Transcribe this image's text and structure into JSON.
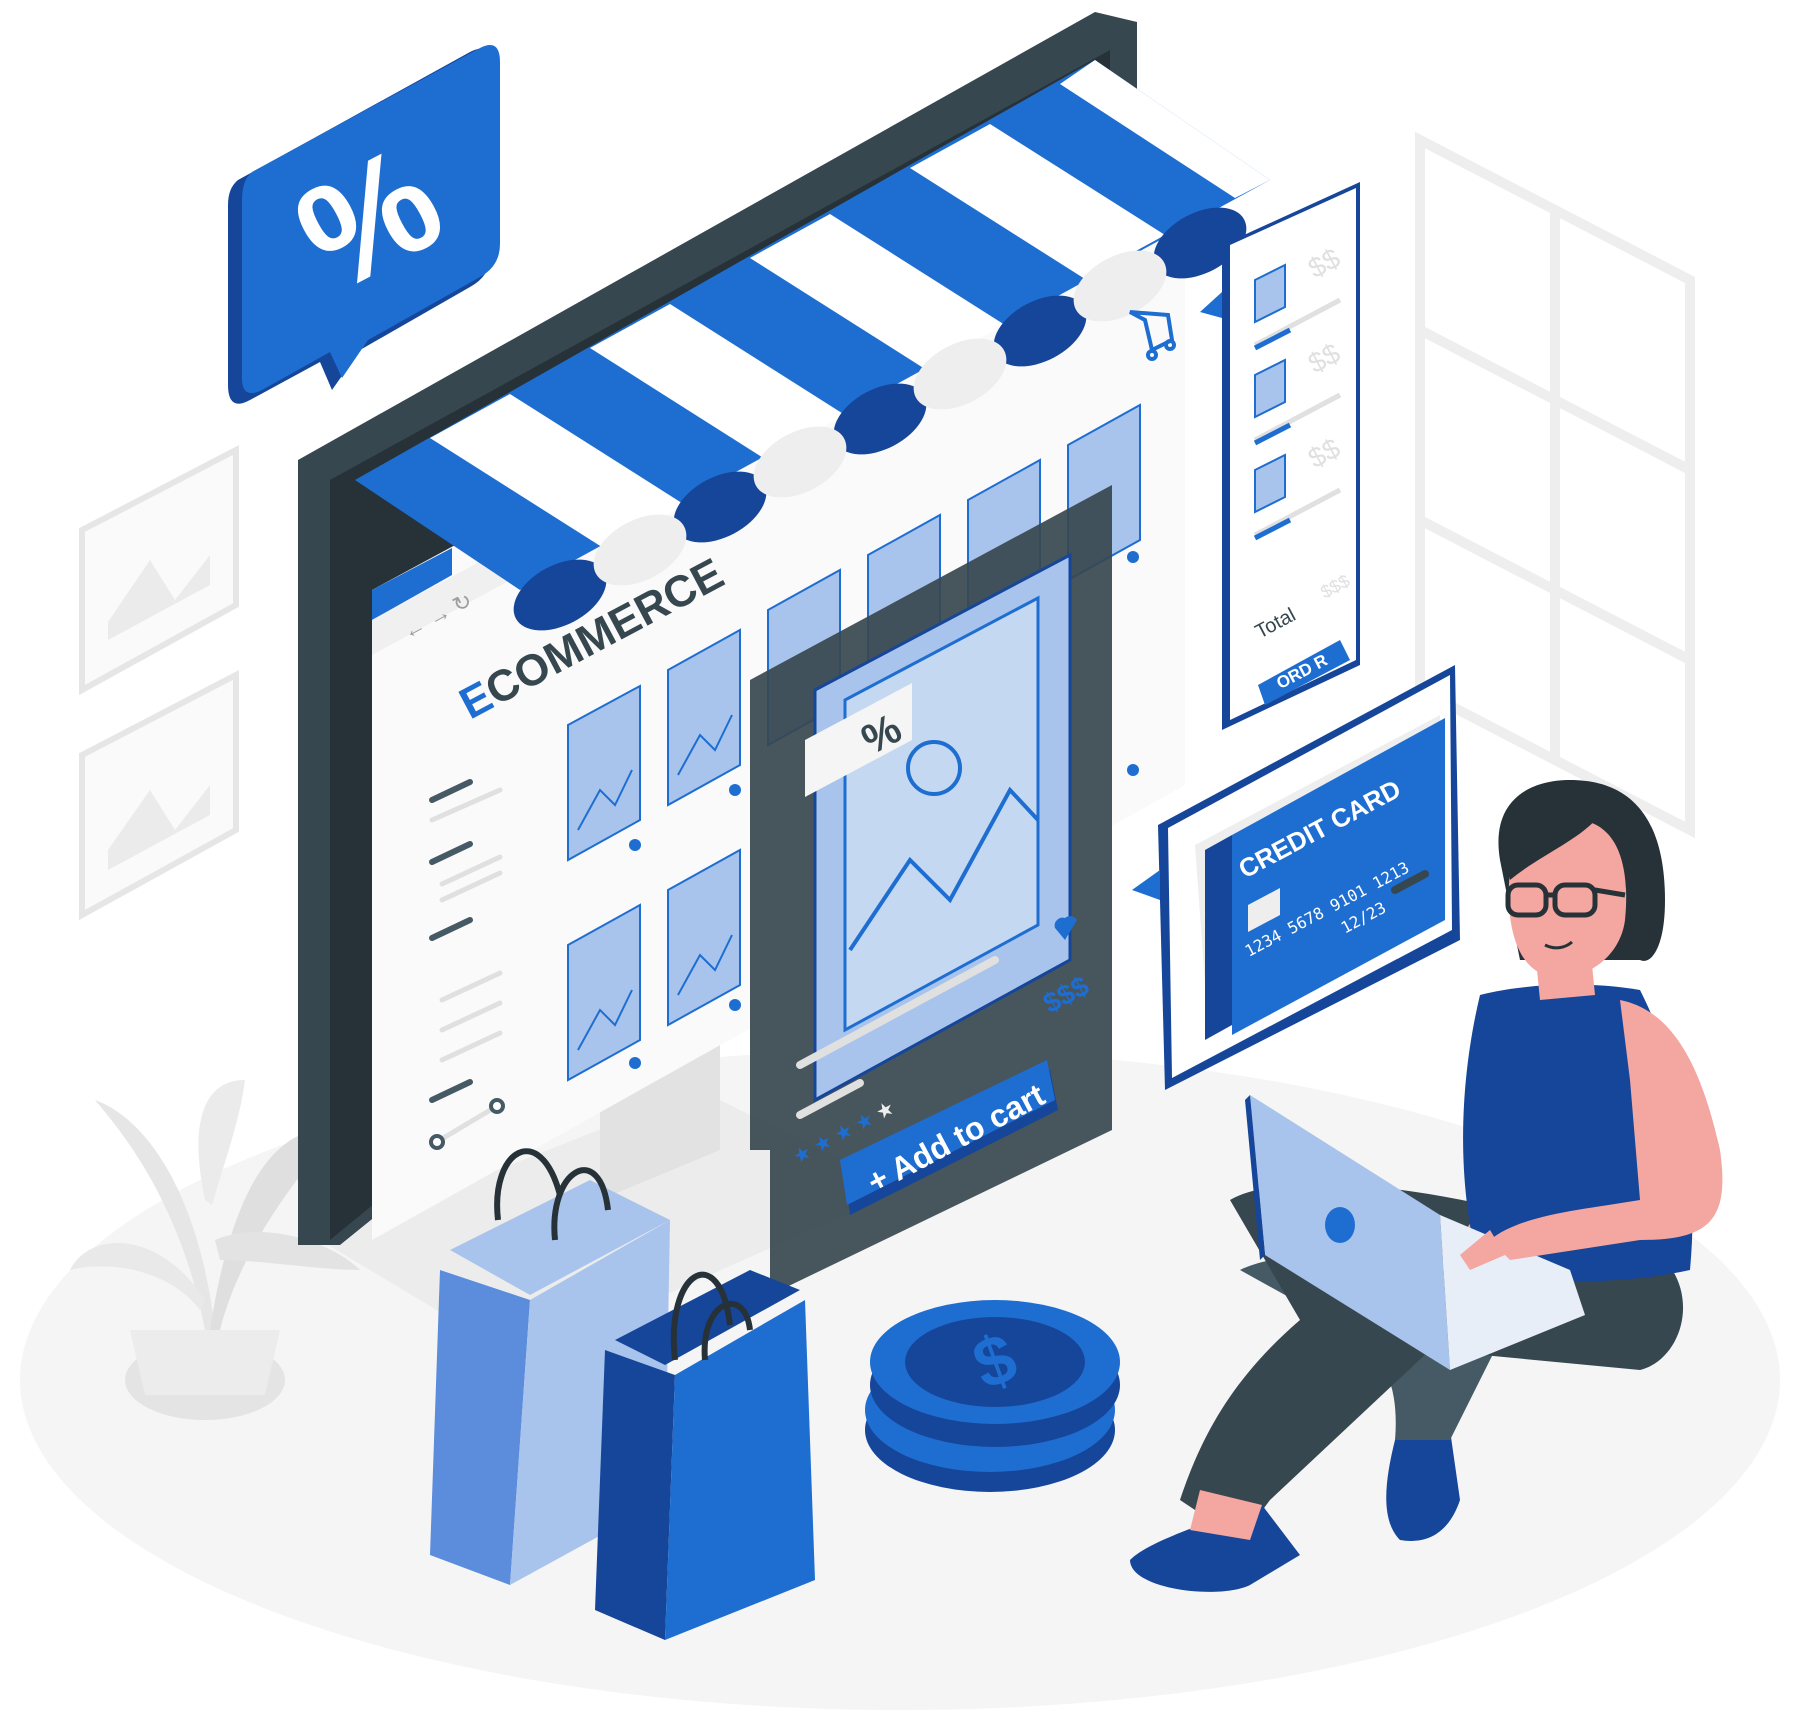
{
  "badge": {
    "symbol": "%"
  },
  "store": {
    "brand_initial": "E",
    "brand_rest": "COMMERCE"
  },
  "product_card": {
    "discount_symbol": "%",
    "price": "$$$",
    "add_to_cart_label": "+ Add to cart"
  },
  "cart_panel": {
    "item_price": "$$",
    "total_label": "Total",
    "total_value": "$$$",
    "order_button_label": "ORD  R"
  },
  "credit_card": {
    "title": "CREDIT CARD",
    "number": "1234  5678  9101  1213",
    "expiry": "12/23"
  },
  "coin": {
    "symbol": "$"
  },
  "colors": {
    "primary": "#1e6ed2",
    "primary_dark": "#16469a",
    "primary_light": "#a9c4ec",
    "dark": "#37474f",
    "grey": "#e0e0e0",
    "skin": "#f4a6a0"
  }
}
